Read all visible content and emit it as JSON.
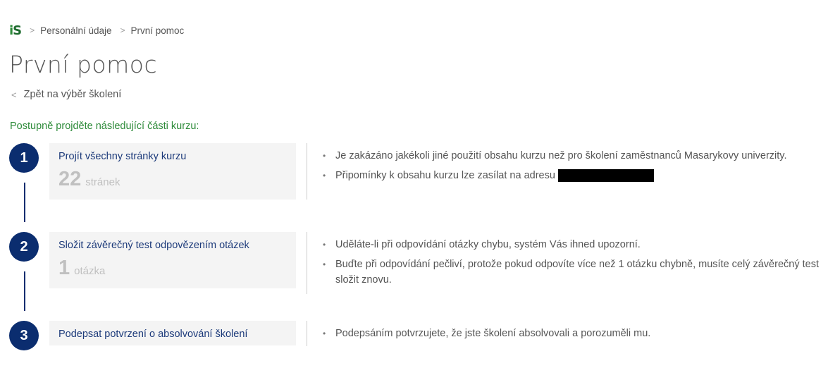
{
  "breadcrumb": {
    "logo_i": "i",
    "logo_s": "S",
    "items": [
      "Personální údaje",
      "První pomoc"
    ]
  },
  "page_title": "První pomoc",
  "back_link": "Zpět na výběr školení",
  "intro": "Postupně projděte následující části kurzu:",
  "steps": [
    {
      "number": "1",
      "title": "Projít všechny stránky kurzu",
      "count": "22",
      "unit": "stránek",
      "notes": [
        "Je zakázáno jakékoli jiné použití obsahu kurzu než pro školení zaměstnanců Masarykovy univerzity.",
        "Připomínky k obsahu kurzu lze zasílat na adresu"
      ]
    },
    {
      "number": "2",
      "title": "Složit závěrečný test odpovězením otázek",
      "count": "1",
      "unit": "otázka",
      "notes": [
        "Uděláte-li při odpovídání otázky chybu, systém Vás ihned upozorní.",
        "Buďte při odpovídání pečliví, protože pokud odpovíte více než 1 otázku chybně, musíte celý závěrečný test složit znovu."
      ]
    },
    {
      "number": "3",
      "title": "Podepsat potvrzení o absolvování školení",
      "notes": [
        "Podepsáním potvrzujete, že jste školení absolvovali a porozuměli mu."
      ]
    }
  ],
  "colors": {
    "step_circle": "#0b2d6f",
    "card_title": "#1c3a7a",
    "intro_green": "#2e8b3a",
    "card_bg": "#f4f4f4"
  }
}
